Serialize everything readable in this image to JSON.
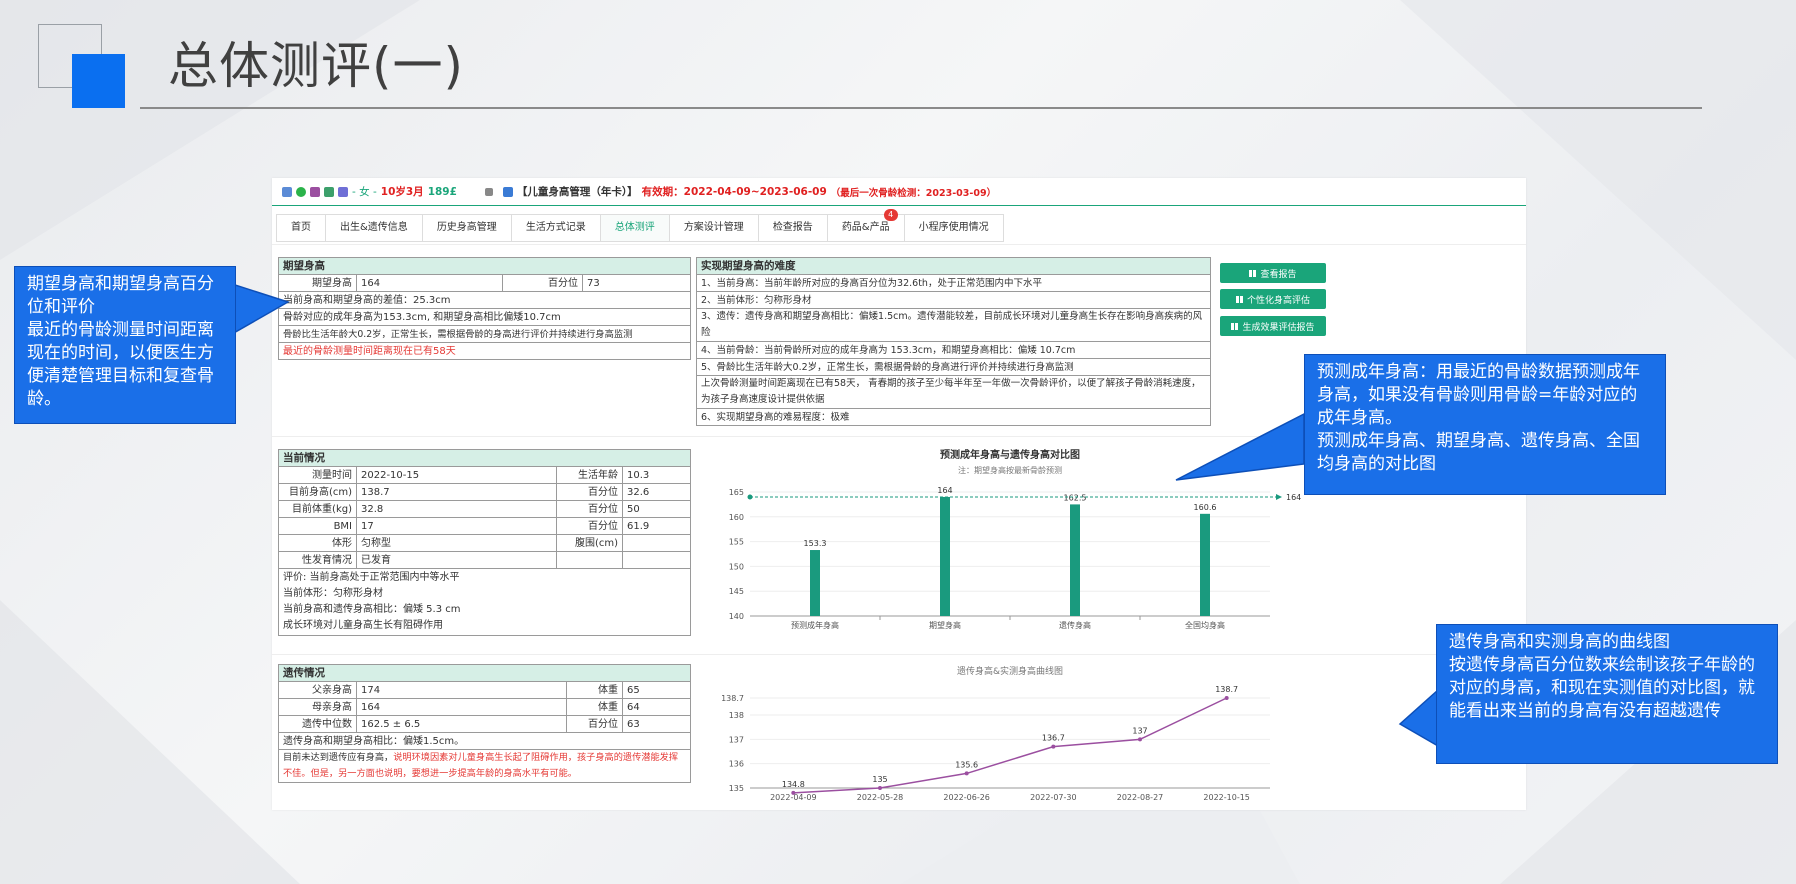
{
  "page": {
    "title": "总体测评(一)"
  },
  "patient": {
    "gender_age": "- 女 - ",
    "age": "10岁3月",
    "phone": "189£",
    "plan": "【儿童身高管理（年卡）】",
    "validity": "有效期：2022-04-09~2023-06-09",
    "last_check": "（最后一次骨龄检测：2023-03-09）"
  },
  "tabs": [
    {
      "label": "首页"
    },
    {
      "label": "出生&遗传信息"
    },
    {
      "label": "历史身高管理"
    },
    {
      "label": "生活方式记录"
    },
    {
      "label": "总体测评"
    },
    {
      "label": "方案设计管理"
    },
    {
      "label": "检查报告"
    },
    {
      "label": "药品&产品",
      "badge": "4"
    },
    {
      "label": "小程序使用情况"
    }
  ],
  "expected": {
    "title": "期望身高",
    "height_label": "期望身高",
    "height": "164",
    "pct_label": "百分位",
    "pct": "73",
    "line1": "当前身高和期望身高的差值：25.3cm",
    "line2": "骨龄对应的成年身高为153.3cm, 和期望身高相比偏矮10.7cm",
    "line3": "骨龄比生活年龄大0.2岁，正常生长，需根据骨龄的身高进行评价并持续进行身高监测",
    "line4": "最近的骨龄测量时间距离现在已有58天"
  },
  "difficulty": {
    "title": "实现期望身高的难度",
    "items": [
      "1、当前身高：当前年龄所对应的身高百分位为32.6th，处于正常范围内中下水平",
      "2、当前体形：匀称形身材",
      "3、遗传：遗传身高和期望身高相比：偏矮1.5cm。遗传潜能较差，目前成长环境对儿童身高生长存在影响身高疾病的风险",
      "4、当前骨龄：当前骨龄所对应的成年身高为 153.3cm，和期望身高相比：偏矮 10.7cm",
      "5、骨龄比生活年龄大0.2岁，正常生长，需根据骨龄的身高进行评价并持续进行身高监测",
      "上次骨龄测量时间距离现在已有58天， 青春期的孩子至少每半年至一年做一次骨龄评价，以便了解孩子骨龄消耗速度，为孩子身高速度设计提供依据",
      "6、实现期望身高的难易程度：极难"
    ]
  },
  "buttons": {
    "report": "查看报告",
    "personal": "个性化身高评估",
    "generate": "生成效果评估报告"
  },
  "current": {
    "title": "当前情况",
    "rows": [
      {
        "l1": "测量时间",
        "v1": "2022-10-15",
        "l2": "生活年龄",
        "v2": "10.3"
      },
      {
        "l1": "目前身高(cm)",
        "v1": "138.7",
        "l2": "百分位",
        "v2": "32.6"
      },
      {
        "l1": "目前体重(kg)",
        "v1": "32.8",
        "l2": "百分位",
        "v2": "50"
      },
      {
        "l1": "BMI",
        "v1": "17",
        "l2": "百分位",
        "v2": "61.9"
      },
      {
        "l1": "体形",
        "v1": "匀称型",
        "l2": "腹围(cm)",
        "v2": ""
      },
      {
        "l1": "性发育情况",
        "v1": "已发育",
        "l2": "",
        "v2": ""
      }
    ],
    "eval": [
      "评价:  当前身高处于正常范围内中等水平",
      "当前体形：匀称形身材",
      "当前身高和遗传身高相比：偏矮 5.3 cm",
      "成长环境对儿童身高生长有阻碍作用"
    ]
  },
  "genetic": {
    "title": "遗传情况",
    "rows": [
      {
        "l1": "父亲身高",
        "v1": "174",
        "l2": "体重",
        "v2": "65"
      },
      {
        "l1": "母亲身高",
        "v1": "164",
        "l2": "体重",
        "v2": "64"
      },
      {
        "l1": "遗传中位数",
        "v1": "162.5 ± 6.5",
        "l2": "百分位",
        "v2": "63"
      }
    ],
    "line1": "遗传身高和期望身高相比：偏矮1.5cm。",
    "line2a": "目前未达到遗传应有身高，",
    "line2b": "说明环境因素对儿童身高生长起了阻碍作用，孩子身高的遗传潜能发挥不佳。但是，另一方面也说明，要想进一步提高年龄的身高水平有可能。"
  },
  "chart_data": [
    {
      "type": "bar",
      "title": "预测成年身高与遗传身高对比图",
      "subtitle": "注：期望身高按最新骨龄预测",
      "categories": [
        "预测成年身高",
        "期望身高",
        "遗传身高",
        "全国均身高"
      ],
      "values": [
        153.3,
        164,
        162.5,
        160.6
      ],
      "ylim": [
        140,
        165
      ],
      "yticks": [
        140,
        145,
        150,
        155,
        160,
        165
      ],
      "reference_line": {
        "value": 164,
        "label": "164"
      },
      "color": "#1a9a7e"
    },
    {
      "type": "line",
      "title": "遗传身高&实测身高曲线图",
      "x": [
        "2022-04-09",
        "2022-05-28",
        "2022-06-26",
        "2022-07-30",
        "2022-08-27",
        "2022-10-15"
      ],
      "values": [
        134.8,
        135,
        135.6,
        136.7,
        137,
        138.7
      ],
      "ylim": [
        135,
        138.7
      ],
      "yticks": [
        135,
        136,
        137,
        138,
        138.7
      ],
      "color": "#9b4fa0"
    }
  ],
  "callouts": {
    "left": "期望身高和期望身高百分位和评价\n最近的骨龄测量时间距离现在的时间，以便医生方便清楚管理目标和复查骨龄。",
    "right_top": "预测成年身高：用最近的骨龄数据预测成年身高，如果没有骨龄则用骨龄=年龄对应的成年身高。\n预测成年身高、期望身高、遗传身高、全国均身高的对比图",
    "right_bottom": "遗传身高和实测身高的曲线图\n按遗传身高百分位数来绘制该孩子年龄的对应的身高，和现在实测值的对比图，就能看出来当前的身高有没有超越遗传"
  }
}
